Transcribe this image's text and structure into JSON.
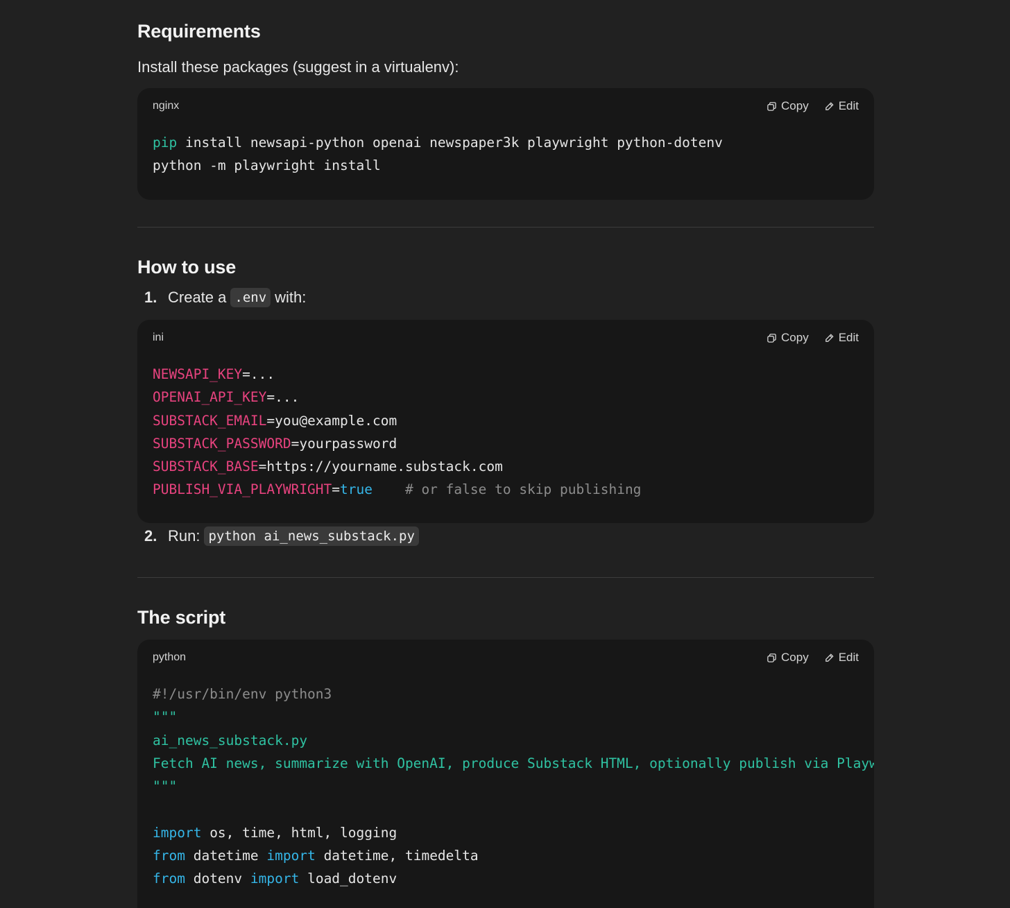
{
  "requirements": {
    "heading": "Requirements",
    "intro": "Install these packages (suggest in a virtualenv):",
    "code": {
      "language": "nginx",
      "copy_label": "Copy",
      "edit_label": "Edit",
      "lines": [
        [
          {
            "t": "pip",
            "c": "teal"
          },
          {
            "t": " install newsapi-python openai newspaper3k playwright python-dotenv",
            "c": ""
          }
        ],
        [
          {
            "t": "python -m playwright install",
            "c": ""
          }
        ]
      ]
    }
  },
  "how_to_use": {
    "heading": "How to use",
    "step1": {
      "number": "1.",
      "before": "Create a",
      "code": ".env",
      "after": "with:"
    },
    "code": {
      "language": "ini",
      "copy_label": "Copy",
      "edit_label": "Edit",
      "lines": [
        [
          {
            "t": "NEWSAPI_KEY",
            "c": "pink"
          },
          {
            "t": "=...",
            "c": ""
          }
        ],
        [
          {
            "t": "OPENAI_API_KEY",
            "c": "pink"
          },
          {
            "t": "=...",
            "c": ""
          }
        ],
        [
          {
            "t": "SUBSTACK_EMAIL",
            "c": "pink"
          },
          {
            "t": "=you@example.com",
            "c": ""
          }
        ],
        [
          {
            "t": "SUBSTACK_PASSWORD",
            "c": "pink"
          },
          {
            "t": "=yourpassword",
            "c": ""
          }
        ],
        [
          {
            "t": "SUBSTACK_BASE",
            "c": "pink"
          },
          {
            "t": "=https://yourname.substack.com",
            "c": ""
          }
        ],
        [
          {
            "t": "PUBLISH_VIA_PLAYWRIGHT",
            "c": "pink"
          },
          {
            "t": "=",
            "c": ""
          },
          {
            "t": "true",
            "c": "blue"
          },
          {
            "t": "    # or false to skip publishing",
            "c": "gray"
          }
        ]
      ]
    },
    "step2": {
      "number": "2.",
      "before": "Run:",
      "code": "python ai_news_substack.py"
    }
  },
  "script": {
    "heading": "The script",
    "code": {
      "language": "python",
      "copy_label": "Copy",
      "edit_label": "Edit",
      "lines": [
        [
          {
            "t": "#!/usr/bin/env python3",
            "c": "gray"
          }
        ],
        [
          {
            "t": "\"\"\"",
            "c": "teal"
          }
        ],
        [
          {
            "t": "ai_news_substack.py",
            "c": "teal"
          }
        ],
        [
          {
            "t": "Fetch AI news, summarize with OpenAI, produce Substack HTML, optionally publish via Playw",
            "c": "teal"
          }
        ],
        [
          {
            "t": "\"\"\"",
            "c": "teal"
          }
        ],
        [
          {
            "t": "",
            "c": ""
          }
        ],
        [
          {
            "t": "import",
            "c": "blue"
          },
          {
            "t": " os, time, html, logging",
            "c": ""
          }
        ],
        [
          {
            "t": "from",
            "c": "blue"
          },
          {
            "t": " datetime ",
            "c": ""
          },
          {
            "t": "import",
            "c": "blue"
          },
          {
            "t": " datetime, timedelta",
            "c": ""
          }
        ],
        [
          {
            "t": "from",
            "c": "blue"
          },
          {
            "t": " dotenv ",
            "c": ""
          },
          {
            "t": "import",
            "c": "blue"
          },
          {
            "t": " load_dotenv",
            "c": ""
          }
        ]
      ]
    }
  },
  "colors": {
    "background": "#212121",
    "code_background": "#171717",
    "teal": "#2fc2a2",
    "pink": "#e8437f",
    "blue": "#35b6e8",
    "comment_gray": "#8c8c8c"
  }
}
